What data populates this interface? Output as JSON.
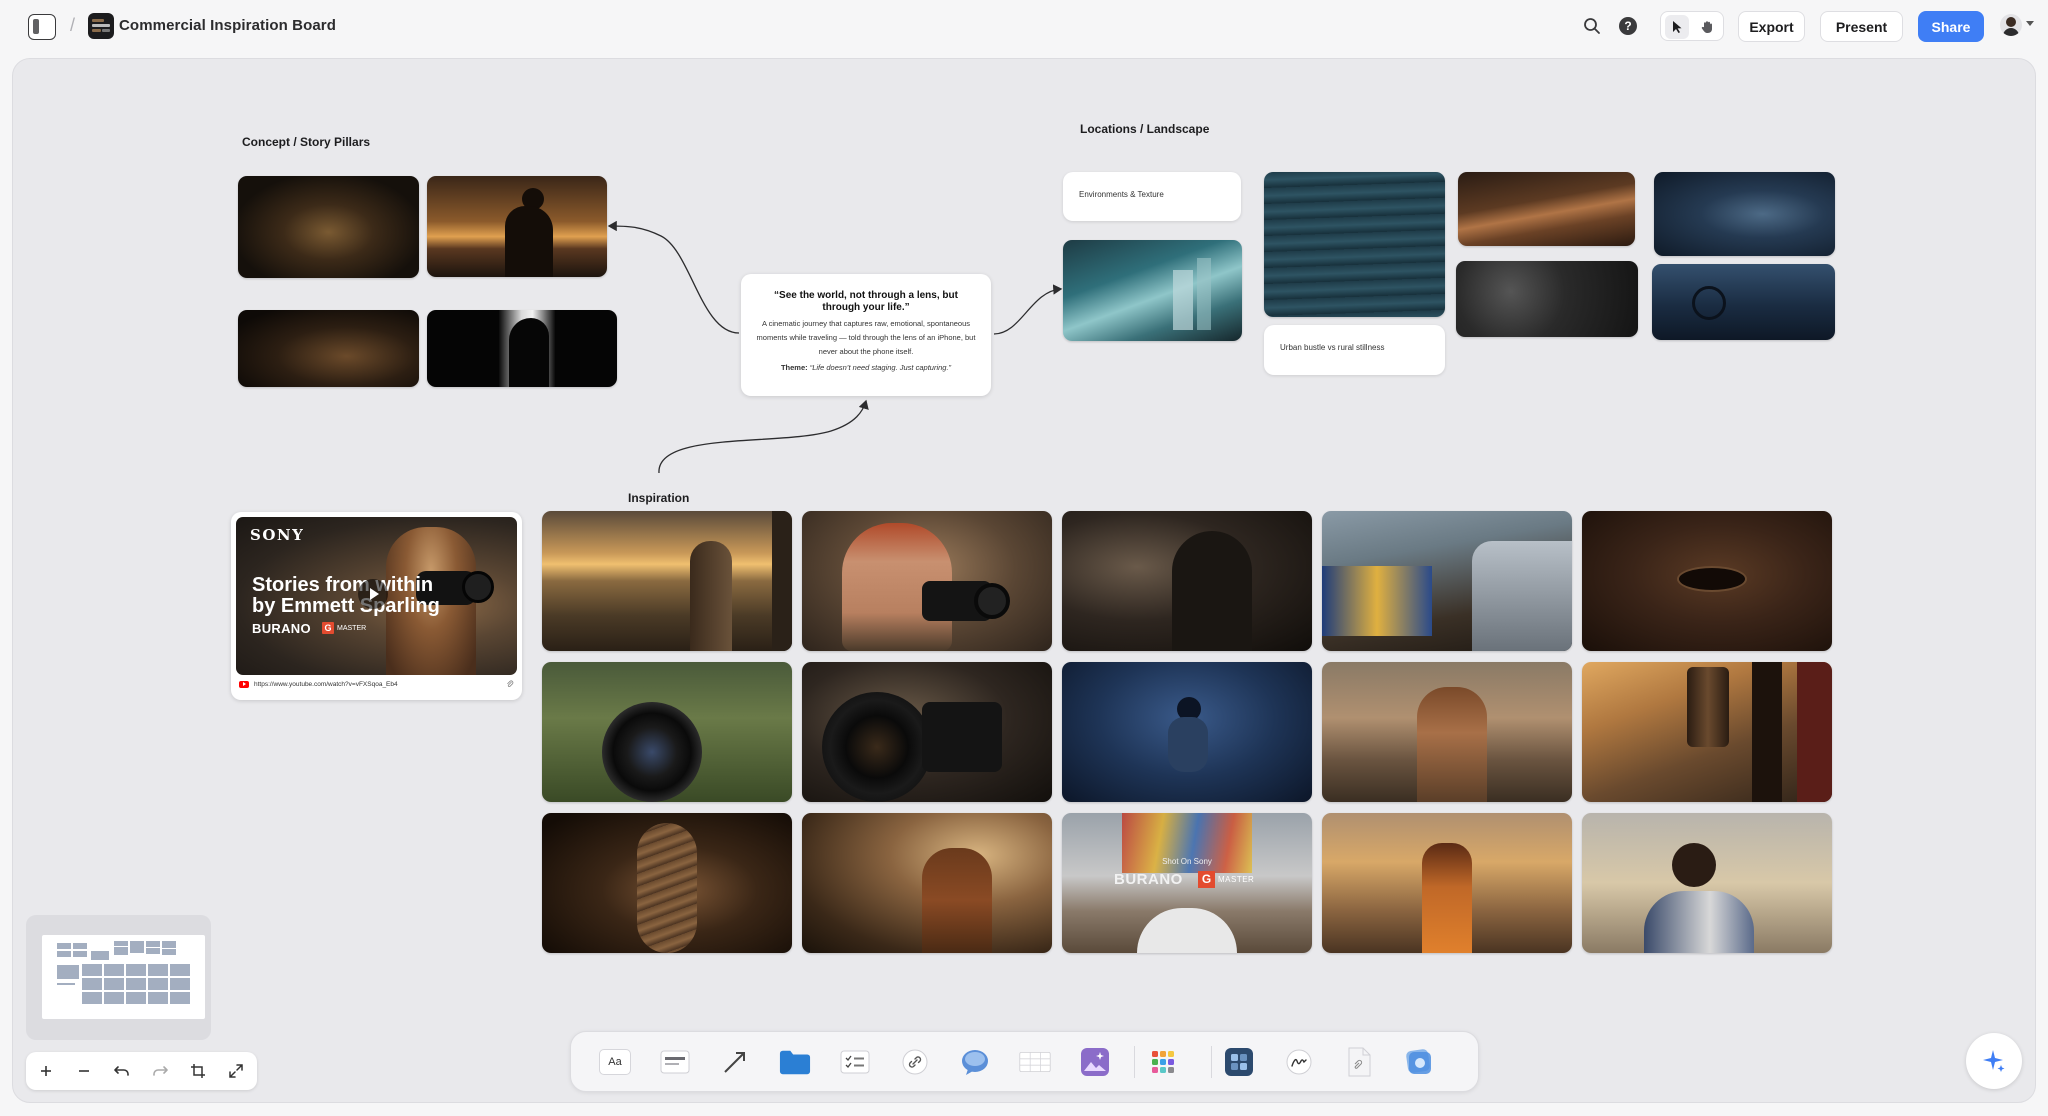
{
  "app": {
    "board_title": "Commercial Inspiration Board",
    "breadcrumb_separator": "/"
  },
  "header": {
    "export_label": "Export",
    "present_label": "Present",
    "share_label": "Share",
    "help_glyph": "?",
    "icons": [
      "sidebar-toggle-icon",
      "board-icon",
      "search-icon",
      "help-icon",
      "pointer-icon",
      "hand-icon",
      "avatar",
      "chevron-down-icon"
    ]
  },
  "canvas": {
    "sections": {
      "concept": "Concept / Story Pillars",
      "locations": "Locations / Landscape",
      "inspiration": "Inspiration"
    },
    "notes": {
      "environments": "Environments & Texture",
      "urban": "Urban bustle vs rural stillness"
    },
    "quote_card": {
      "title": "“See the world, not through a lens, but through your life.”",
      "body": "A cinematic journey that captures raw, emotional, spontaneous moments while traveling — told through the lens of an iPhone, but never about the phone itself.",
      "theme_label": "Theme:",
      "theme_value": "“Life doesn’t need staging. Just capturing.”"
    },
    "youtube_card": {
      "brand": "SONY",
      "title": "Stories from within by Emmett Sparling",
      "subtitle": "BURANO",
      "badge_letter": "G",
      "badge_text": "MASTER",
      "url": "https://www.youtube.com/watch?v=vFXSqoa_Eb4"
    },
    "inspiration_overlay": {
      "small": "Shot On Sony",
      "brand": "BURANO",
      "badge_letter": "G",
      "badge_text": "MASTER"
    }
  },
  "toolbar": {
    "text_tool_label": "Aa",
    "tools": [
      "text-tool",
      "note-tool",
      "arrow-tool",
      "folder-tool",
      "checklist-tool",
      "link-tool",
      "comment-tool",
      "table-tool",
      "image-tool",
      "apps-tool",
      "board-tool",
      "draw-tool",
      "file-tool",
      "sketch-tool"
    ]
  },
  "zoom": {
    "controls": [
      "zoom-in",
      "zoom-out",
      "undo",
      "redo",
      "fit",
      "fullscreen"
    ]
  },
  "colors": {
    "accent": "#3f7ef5",
    "canvas_bg": "#e9e9ec",
    "youtube_red": "#ff0000",
    "gmaster_orange": "#e34b2f"
  }
}
